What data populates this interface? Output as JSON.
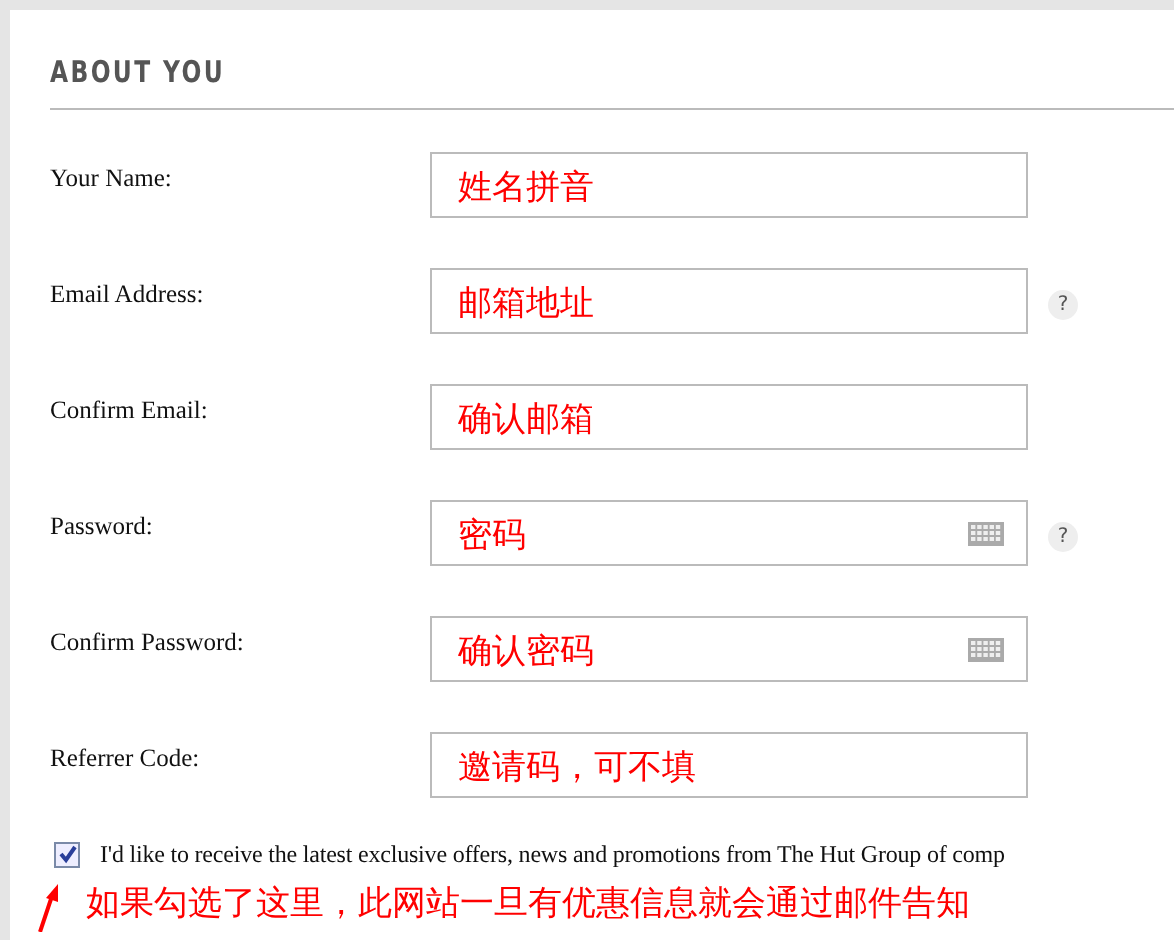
{
  "section": {
    "title": "ABOUT YOU"
  },
  "fields": [
    {
      "label": "Your Name:",
      "value": "姓名拼音",
      "keyboard": false
    },
    {
      "label": "Email Address:",
      "value": "邮箱地址",
      "keyboard": false,
      "help": "?"
    },
    {
      "label": "Confirm Email:",
      "value": "确认邮箱",
      "keyboard": false
    },
    {
      "label": "Password:",
      "value": "密码",
      "keyboard": true,
      "help": "?"
    },
    {
      "label": "Confirm Password:",
      "value": "确认密码",
      "keyboard": true
    },
    {
      "label": "Referrer Code:",
      "value": "邀请码，可不填",
      "keyboard": false
    }
  ],
  "opt_in": {
    "label": "I'd like to receive the latest exclusive offers, news and promotions from The Hut Group of comp",
    "checked": true
  },
  "annotation": {
    "text": "如果勾选了这里，此网站一旦有优惠信息就会通过邮件告知"
  }
}
